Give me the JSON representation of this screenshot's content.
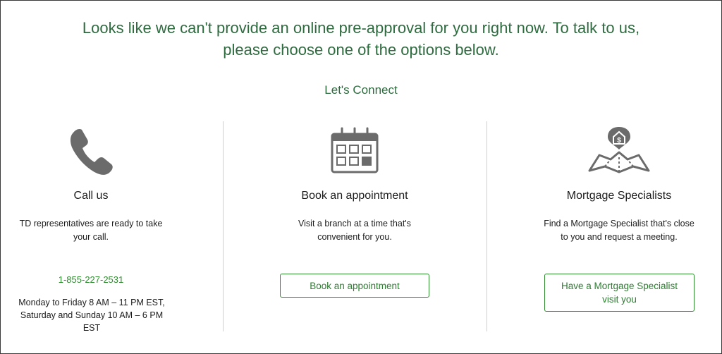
{
  "headline": "Looks like we can't provide an online pre-approval for you right now. To talk to us, please choose one of the options below.",
  "subhead": "Let's Connect",
  "colors": {
    "accent_green": "#2e6b3f",
    "link_green": "#2e8b2e",
    "icon_gray": "#6b6b6b"
  },
  "options": {
    "call": {
      "icon": "phone-icon",
      "title": "Call us",
      "description": "TD representatives are ready to take your call.",
      "phone": "1-855-227-2531",
      "hours": "Monday to Friday 8 AM – 11 PM EST, Saturday and Sunday 10 AM – 6 PM EST"
    },
    "appointment": {
      "icon": "calendar-icon",
      "title": "Book an appointment",
      "description": "Visit a branch at a time that's convenient for you.",
      "button": "Book an appointment"
    },
    "specialist": {
      "icon": "map-pin-house-dollar-icon",
      "title": "Mortgage Specialists",
      "description": "Find a Mortgage Specialist that's close to you and request a meeting.",
      "button": "Have a Mortgage Specialist visit you"
    }
  }
}
